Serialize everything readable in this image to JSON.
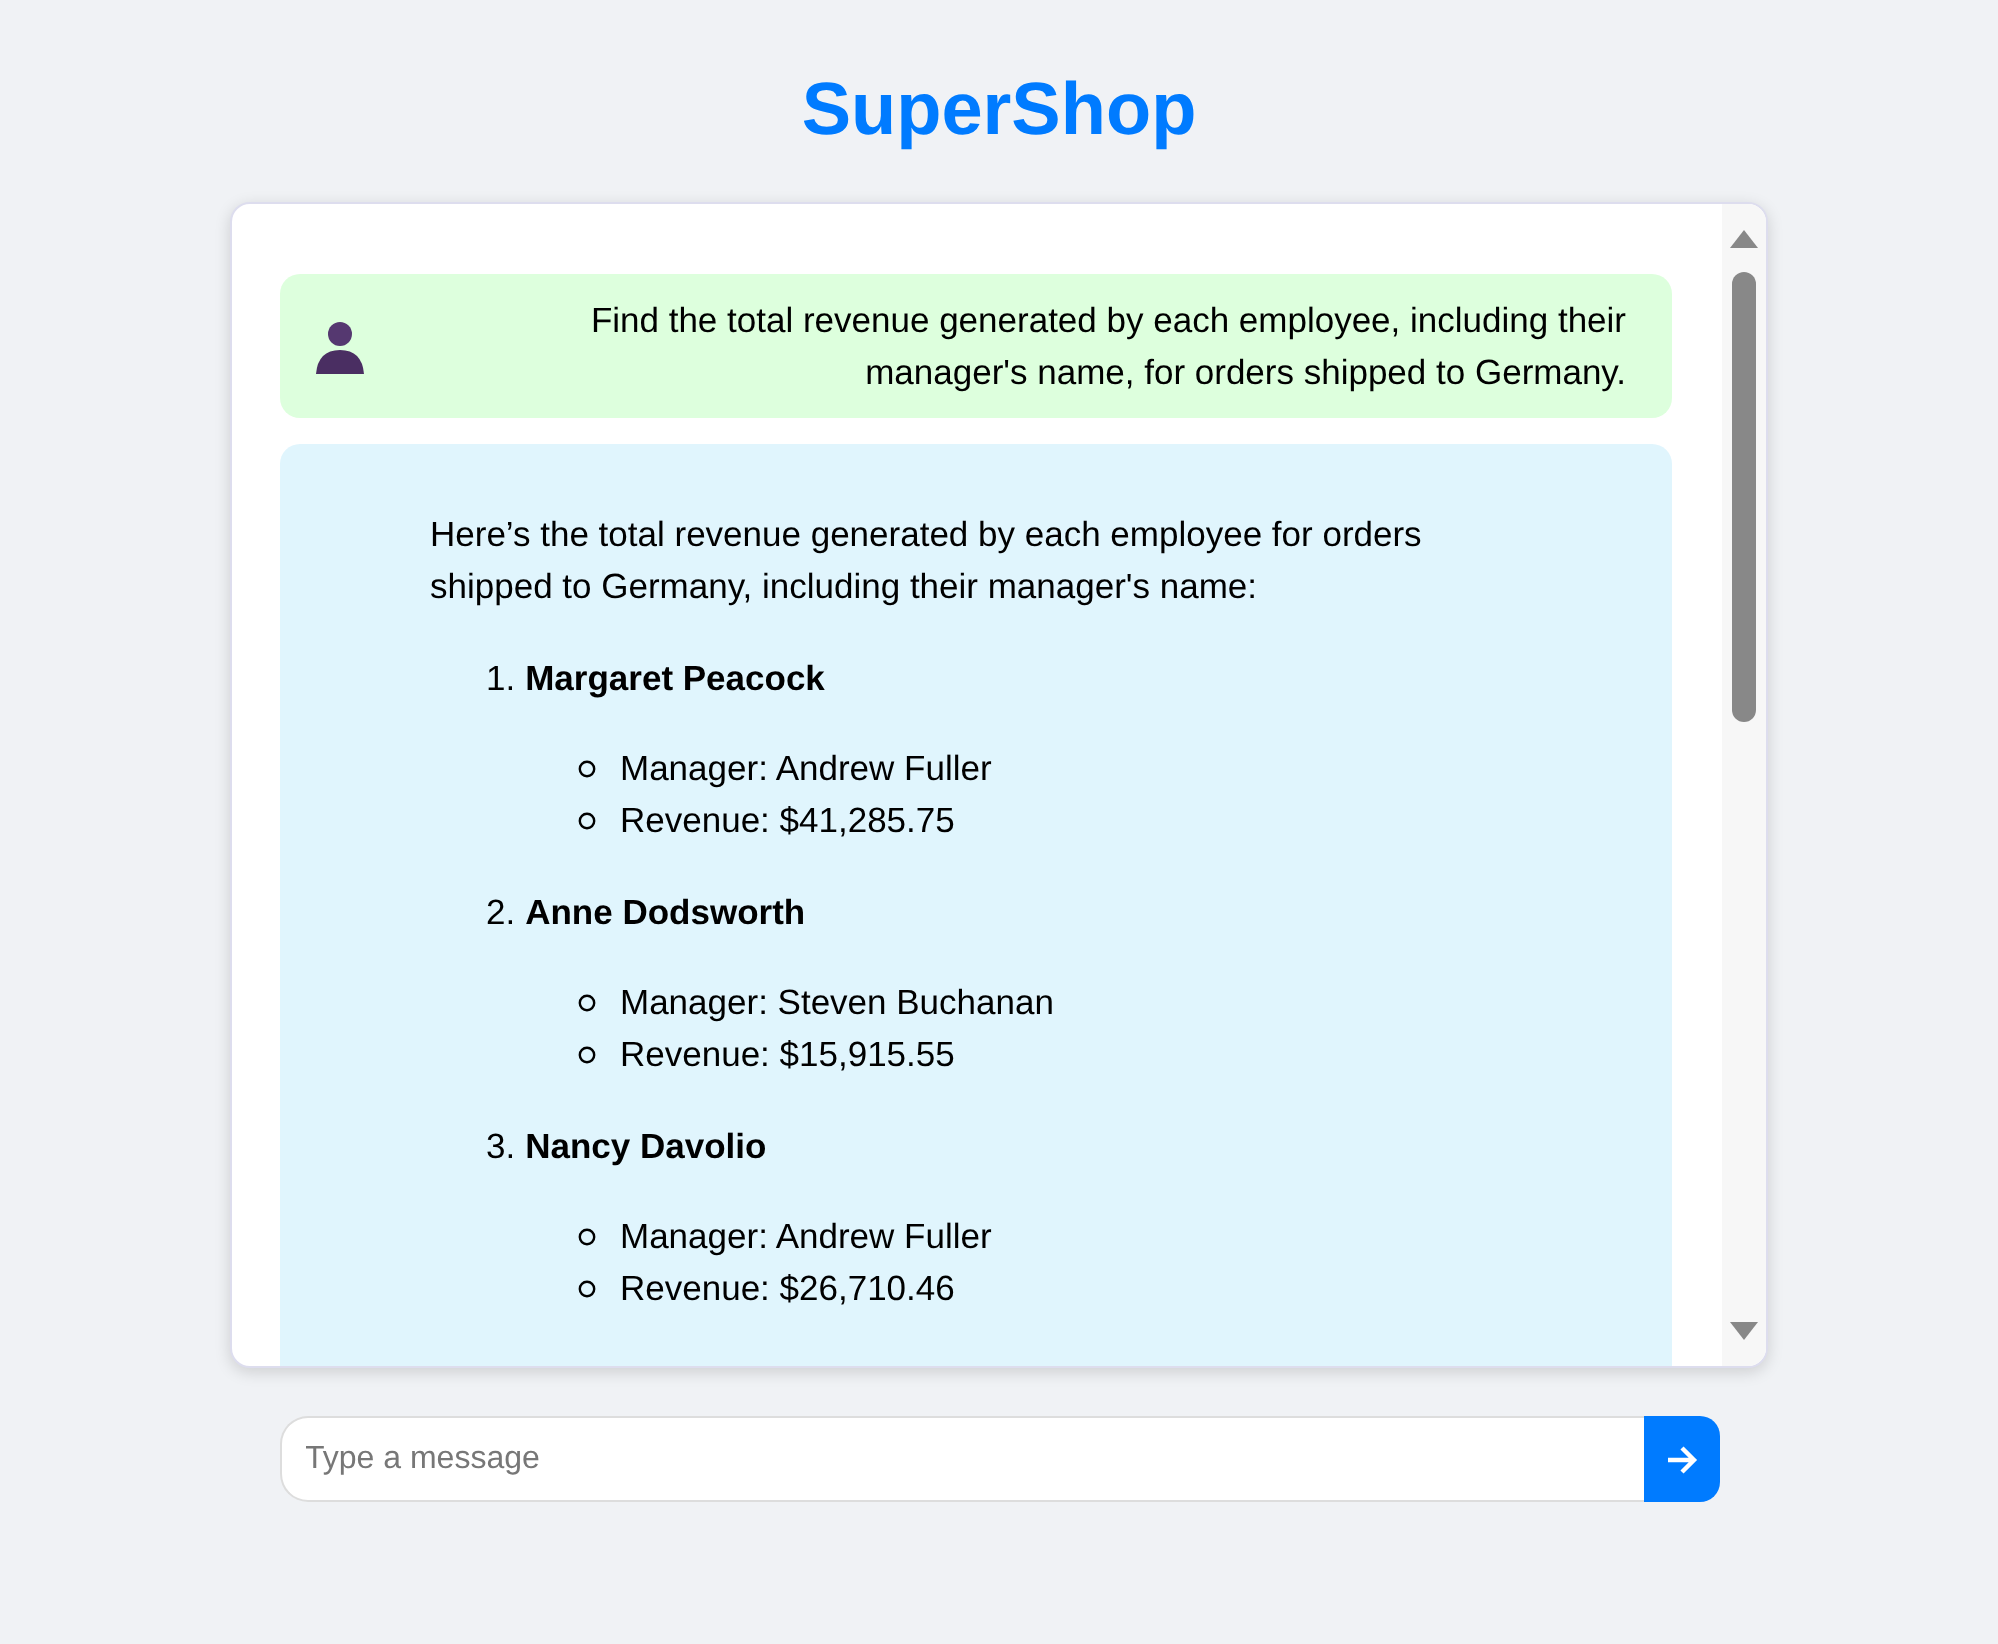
{
  "title": "SuperShop",
  "messages": [
    {
      "kind": "user",
      "text": "Find the total revenue generated by each employee, including their manager's name, for orders shipped to Germany."
    },
    {
      "kind": "assistant",
      "intro": "Here’s the total revenue generated by each employee for orders shipped to Germany, including their manager's name:",
      "items": [
        {
          "number": "1.",
          "name": "Margaret Peacock",
          "details": [
            "Manager: Andrew Fuller",
            "Revenue: $41,285.75"
          ]
        },
        {
          "number": "2.",
          "name": "Anne Dodsworth",
          "details": [
            "Manager: Steven Buchanan",
            "Revenue: $15,915.55"
          ]
        },
        {
          "number": "3.",
          "name": "Nancy Davolio",
          "details": [
            "Manager: Andrew Fuller",
            "Revenue: $26,710.46"
          ]
        }
      ]
    }
  ],
  "input": {
    "placeholder": "Type a message"
  }
}
